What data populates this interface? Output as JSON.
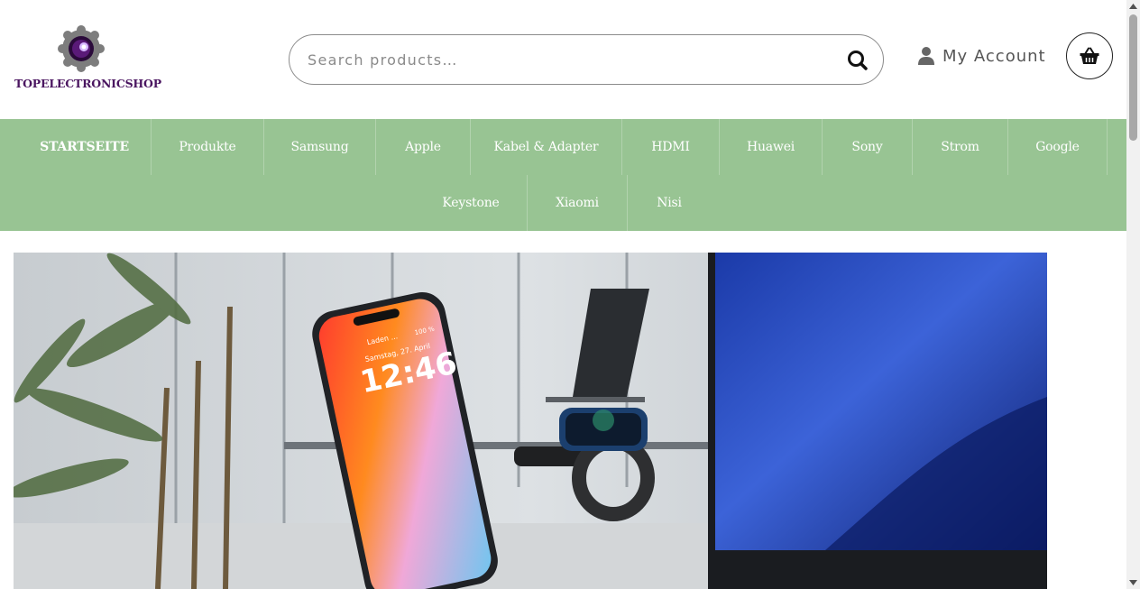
{
  "brand": {
    "name": "TOPELECTRONICSHOP"
  },
  "search": {
    "placeholder": "Search products…"
  },
  "account": {
    "label": "My Account"
  },
  "colors": {
    "nav_bg": "#98c493",
    "brand_purple": "#4a1560"
  },
  "nav": {
    "row1": [
      "STARTSEITE",
      "Produkte",
      "Samsung",
      "Apple",
      "Kabel & Adapter",
      "HDMI",
      "Huawei",
      "Sony",
      "Strom",
      "Google"
    ],
    "row2": [
      "Keystone",
      "Xiaomi",
      "Nisi"
    ]
  },
  "hero": {
    "phone_date": "Samstag, 27. April",
    "phone_time": "12:46",
    "phone_status_left": "Laden ...",
    "phone_status_right": "100 %"
  },
  "icons": {
    "search": "search-icon",
    "account": "user-icon",
    "cart": "basket-icon"
  }
}
